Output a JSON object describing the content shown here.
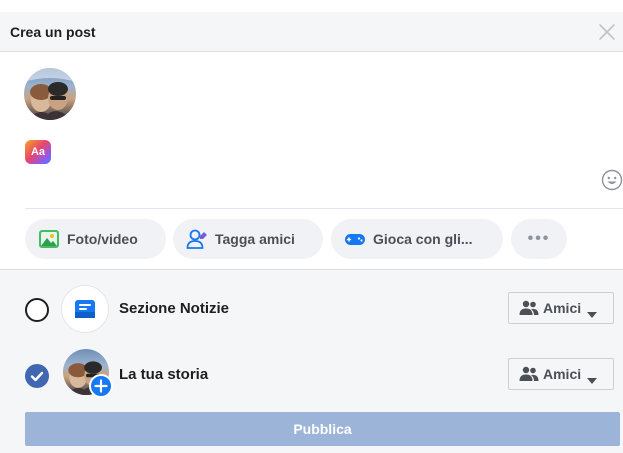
{
  "header": {
    "title": "Crea un post"
  },
  "composer": {
    "placeholder": "",
    "aa_label": "Aa"
  },
  "actions": {
    "photo_label": "Foto/video",
    "tag_label": "Tagga amici",
    "game_label": "Gioca con gli...",
    "more_label": "•••"
  },
  "destinations": [
    {
      "label": "Sezione Notizie",
      "selected": false,
      "audience": "Amici"
    },
    {
      "label": "La tua storia",
      "selected": true,
      "audience": "Amici"
    }
  ],
  "publish_label": "Pubblica",
  "colors": {
    "accent": "#4267b2",
    "publish_disabled": "#9cb4d8",
    "header_bg": "#f5f6f7"
  }
}
